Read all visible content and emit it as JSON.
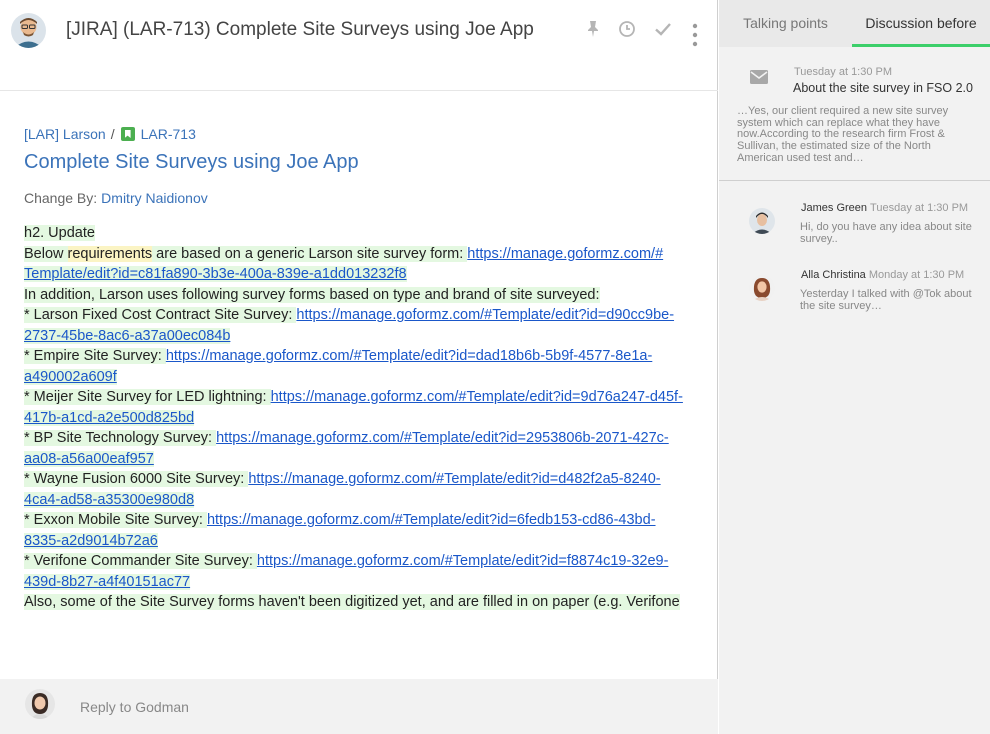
{
  "header": {
    "title": "[JIRA] (LAR-713) Complete Site Surveys using Joe App",
    "icons": [
      "pin-icon",
      "clock-icon",
      "check-icon",
      "more-vertical-icon"
    ]
  },
  "issue": {
    "project_link": "[LAR] Larson",
    "separator": "/",
    "issue_key": "LAR-713",
    "title": "Complete Site Surveys using Joe App",
    "change_by_label": "Change By:",
    "change_by_name": "Dmitry Naidionov"
  },
  "body": {
    "heading": "h2. Update",
    "intro_pre": "Below ",
    "intro_hl": "requirements",
    "intro_post": " are based on a generic Larson site survey form: ",
    "intro_url_1": "https://manage.goformz.com/#",
    "intro_url_2": "Template/edit?id=c81fa890-3b3e-400a-839e-a1dd013232f8",
    "addition": "In addition, Larson uses following survey forms based on type and brand of site surveyed:",
    "items": [
      {
        "label": "* Larson Fixed Cost Contract Site Survey: ",
        "url_1": "https://manage.goformz.com/#Template/edit?id=d90cc9be-",
        "url_2": "2737-45be-8ac6-a37a00ec084b"
      },
      {
        "label": "* Empire Site Survey: ",
        "url_1": "https://manage.goformz.com/#Template/edit?id=dad18b6b-5b9f-4577-8e1a-",
        "url_2": "a490002a609f"
      },
      {
        "label": "* Meijer Site Survey for LED lightning: ",
        "url_1": "https://manage.goformz.com/#Template/edit?id=9d76a247-d45f-",
        "url_2": "417b-a1cd-a2e500d825bd"
      },
      {
        "label": "* BP Site Technology Survey: ",
        "url_1": "https://manage.goformz.com/#Template/edit?id=2953806b-2071-427c-",
        "url_2": "aa08-a56a00eaf957"
      },
      {
        "label": "* Wayne Fusion 6000 Site Survey: ",
        "url_1": "https://manage.goformz.com/#Template/edit?id=d482f2a5-8240-",
        "url_2": "4ca4-ad58-a35300e980d8"
      },
      {
        "label": "* Exxon Mobile Site Survey: ",
        "url_1": "https://manage.goformz.com/#Template/edit?id=6fedb153-cd86-43bd-",
        "url_2": "8335-a2d9014b72a6"
      },
      {
        "label": "* Verifone Commander Site Survey: ",
        "url_1": "https://manage.goformz.com/#Template/edit?id=f8874c19-32e9-",
        "url_2": "439d-8b27-a4f40151ac77"
      }
    ],
    "closing": "Also, some of the Site Survey forms haven't been digitized yet, and are filled in on paper (e.g. Verifone"
  },
  "reply": {
    "placeholder": "Reply to Godman"
  },
  "sidebar": {
    "tabs": [
      "Talking points",
      "Discussion before"
    ],
    "active_tab": "Discussion before",
    "email": {
      "time": "Tuesday at 1:30 PM",
      "subject": "About the site survey in FSO 2.0",
      "snippet": "…Yes, our client required a new site survey system which can replace what they have now.According to the research firm Frost & Sullivan, the estimated size of the North American used test and…"
    },
    "messages": [
      {
        "name": "James Green",
        "time": "Tuesday at 1:30 PM",
        "text": "Hi, do you have any idea about site survey.."
      },
      {
        "name": "Alla Christina",
        "time": "Monday  at 1:30 PM",
        "text": "Yesterday I talked with @Tok about the site survey…"
      }
    ]
  },
  "colors": {
    "accent_green": "#3ccf6a",
    "link_blue": "#3b73b9",
    "highlight_green": "#e4f8e1",
    "highlight_yellow": "#fbf4c4"
  }
}
